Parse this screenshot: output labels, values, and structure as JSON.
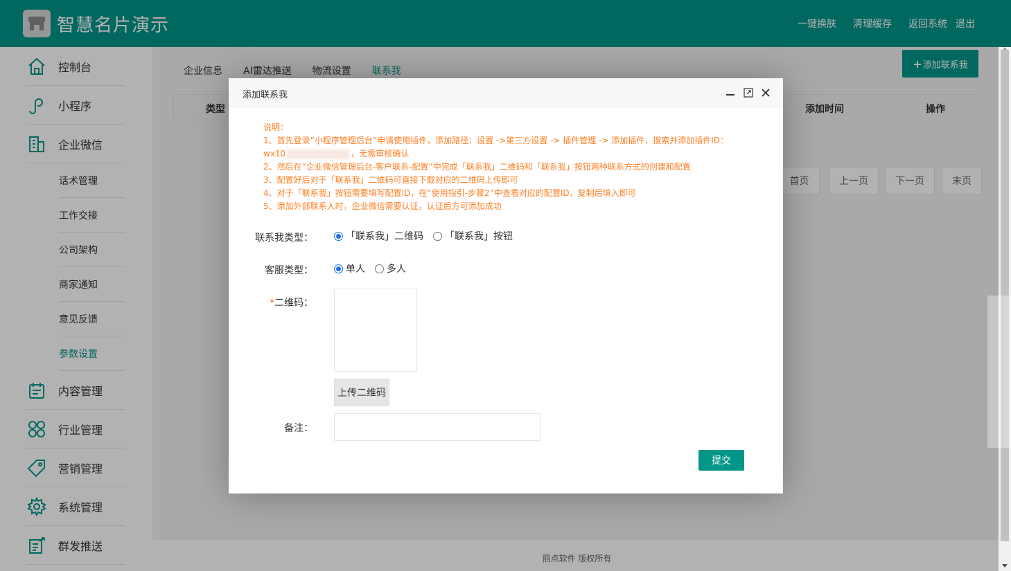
{
  "header": {
    "title": "智慧名片演示",
    "links": [
      "一键换肤",
      "清理缓存",
      "返回系统",
      "退出"
    ]
  },
  "sidebar": {
    "items": [
      {
        "label": "控制台",
        "icon": "home-icon"
      },
      {
        "label": "小程序",
        "icon": "miniprogram-icon"
      },
      {
        "label": "企业微信",
        "icon": "building-icon"
      }
    ],
    "sub_items": [
      "话术管理",
      "工作交接",
      "公司架构",
      "商家通知",
      "意见反馈",
      "参数设置"
    ],
    "active_sub": "参数设置",
    "bottom_items": [
      {
        "label": "内容管理",
        "icon": "calendar-icon"
      },
      {
        "label": "行业管理",
        "icon": "grid-icon"
      },
      {
        "label": "营销管理",
        "icon": "tag-icon"
      },
      {
        "label": "系统管理",
        "icon": "gear-icon"
      },
      {
        "label": "群发推送",
        "icon": "send-icon"
      }
    ]
  },
  "main": {
    "tabs": [
      "企业信息",
      "AI雷达推送",
      "物流设置",
      "联系我"
    ],
    "active_tab": "联系我",
    "add_button": "添加联系我",
    "table_headers": [
      "类型",
      "添加时间",
      "操作"
    ],
    "pager": [
      "首页",
      "上一页",
      "下一页",
      "末页"
    ],
    "footer": "丽点软件 版权所有"
  },
  "dialog": {
    "title": "添加联系我",
    "notes": {
      "heading": "说明：",
      "line1a": "1、首先登录“小程序管理后台”申请使用插件，添加路径：设置 ->第三方设置 -> 插件管理 -> 添加插件，搜索并添加插件ID：",
      "line1b_prefix": "wx10",
      "line1b_suffix": "，无需审核确认",
      "line2": "2、然后在“企业微信管理后台-客户联系-配置”中完成「联系我」二维码和「联系我」按钮两种联系方式的创建和配置",
      "line3": "3、配置好后对于「联系我」二维码可直接下载对应的二维码上传即可",
      "line4": "4、对于「联系我」按钮需要填写配置ID，在“使用指引-步骤2”中查看对应的配置ID，复制后填入即可",
      "line5": "5、添加外部联系人时，企业微信需要认证，认证后方可添加成功"
    },
    "contact_type": {
      "label": "联系我类型：",
      "options": [
        "「联系我」二维码",
        "「联系我」按钮"
      ],
      "selected": "「联系我」二维码"
    },
    "service_type": {
      "label": "客服类型：",
      "options": [
        "单人",
        "多人"
      ],
      "selected": "单人"
    },
    "qrcode": {
      "required_mark": "*",
      "label": "二维码：",
      "upload_label": "上传二维码"
    },
    "remark": {
      "label": "备注：",
      "value": ""
    },
    "submit_label": "提交"
  },
  "colors": {
    "primary": "#009688",
    "note": "#ff7f24"
  }
}
